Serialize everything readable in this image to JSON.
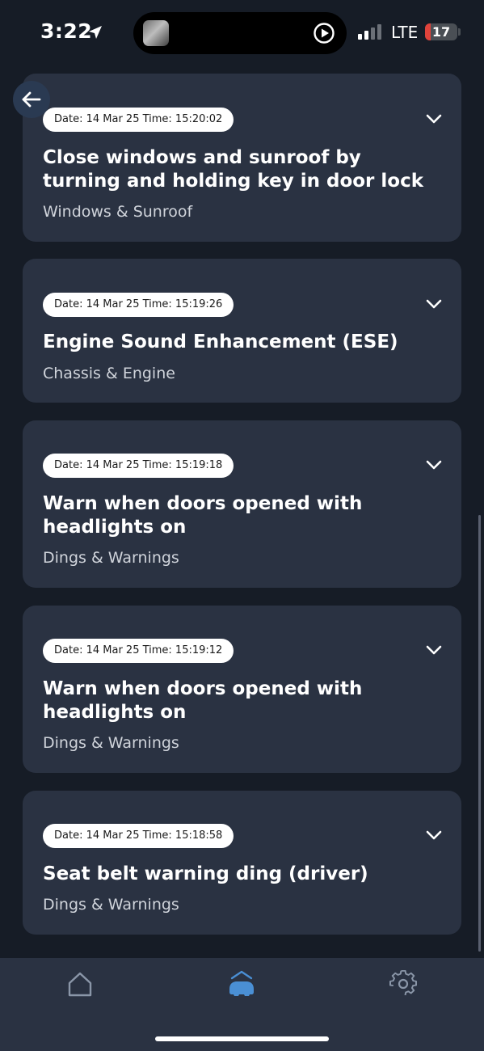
{
  "status_bar": {
    "time": "3:22",
    "network": "LTE",
    "battery_level": "17",
    "battery_fraction": 0.17,
    "battery_color": "#e0433b"
  },
  "icons": {
    "back": "arrow-left-icon",
    "expand": "chevron-down-icon",
    "home": "home-icon",
    "car": "car-icon",
    "settings": "gear-icon"
  },
  "colors": {
    "background": "#161c26",
    "card": "#2a3242",
    "active_tab": "#4a8fd4",
    "inactive_tab": "#8a96a8"
  },
  "history": [
    {
      "date_time": "Date: 14 Mar 25 Time: 15:20:02",
      "title": "Close windows and sunroof by turning and holding key in door lock",
      "category": "Windows & Sunroof"
    },
    {
      "date_time": "Date: 14 Mar 25 Time: 15:19:26",
      "title": "Engine Sound Enhancement (ESE)",
      "category": "Chassis & Engine"
    },
    {
      "date_time": "Date: 14 Mar 25 Time: 15:19:18",
      "title": "Warn when doors opened with headlights on",
      "category": "Dings & Warnings"
    },
    {
      "date_time": "Date: 14 Mar 25 Time: 15:19:12",
      "title": "Warn when doors opened with headlights on",
      "category": "Dings & Warnings"
    },
    {
      "date_time": "Date: 14 Mar 25 Time: 15:18:58",
      "title": "Seat belt warning ding (driver)",
      "category": "Dings & Warnings"
    }
  ],
  "tab_bar": {
    "active_tab": "car"
  }
}
